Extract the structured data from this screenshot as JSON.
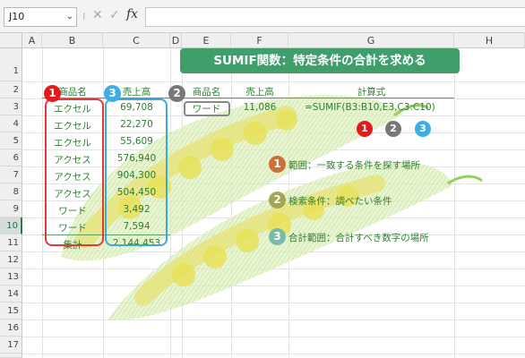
{
  "formula_bar": {
    "name_box": "J10",
    "cancel_icon": "✕",
    "enter_icon": "✓",
    "fx_label": "fx",
    "formula": ""
  },
  "columns": [
    "A",
    "B",
    "C",
    "D",
    "E",
    "F",
    "G",
    "H"
  ],
  "rows": [
    "1",
    "2",
    "3",
    "4",
    "5",
    "6",
    "7",
    "8",
    "9",
    "10",
    "11",
    "12",
    "13",
    "14",
    "15",
    "16",
    "17",
    "18"
  ],
  "title": "SUMIF関数：特定条件の合計を求める",
  "headers": {
    "product": "商品名",
    "sales": "売上高",
    "product2": "商品名",
    "sales2": "売上高",
    "formula": "計算式"
  },
  "table": [
    {
      "product": "エクセル",
      "sales": "69,708"
    },
    {
      "product": "エクセル",
      "sales": "22,270"
    },
    {
      "product": "エクセル",
      "sales": "55,609"
    },
    {
      "product": "アクセス",
      "sales": "576,940"
    },
    {
      "product": "アクセス",
      "sales": "904,300"
    },
    {
      "product": "アクセス",
      "sales": "504,450"
    },
    {
      "product": "ワード",
      "sales": "3,492"
    },
    {
      "product": "ワード",
      "sales": "7,594"
    }
  ],
  "total": {
    "label": "集計",
    "value": "2,144,453"
  },
  "lookup": {
    "product": "ワード",
    "sales": "11,086",
    "formula": "=SUMIF(B3:B10,E3,C3:C10)"
  },
  "markers": {
    "one": "1",
    "two": "2",
    "three": "3"
  },
  "legend": [
    {
      "num": "1",
      "text": "範囲：一致する条件を探す場所"
    },
    {
      "num": "2",
      "text": "検索条件：調べたい条件"
    },
    {
      "num": "3",
      "text": "合計範囲：合計すべき数字の場所"
    }
  ]
}
